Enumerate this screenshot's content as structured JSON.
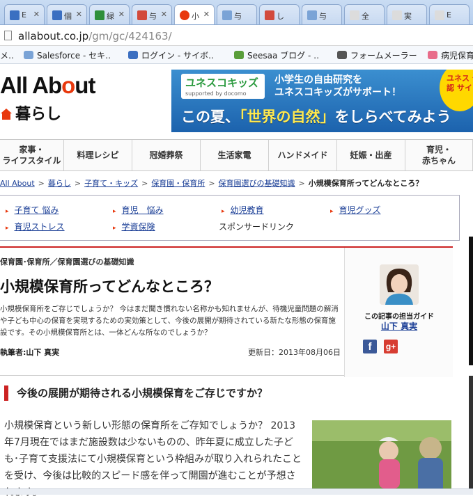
{
  "browser": {
    "tabs": [
      {
        "label": "E",
        "color": "#3b6fc1",
        "active": false
      },
      {
        "label": "個",
        "color": "#3b6fc1",
        "active": false
      },
      {
        "label": "緑",
        "color": "#2f8f3a",
        "active": false
      },
      {
        "label": "与",
        "color": "#d24a3c",
        "active": false
      },
      {
        "label": "小",
        "color": "#e8380d",
        "active": true
      },
      {
        "label": "与",
        "color": "#7aa3d6",
        "active": false
      },
      {
        "label": "し",
        "color": "#d24a3c",
        "active": false
      },
      {
        "label": "与",
        "color": "#7aa3d6",
        "active": false
      },
      {
        "label": "全",
        "color": "#dcdcdc",
        "active": false
      },
      {
        "label": "実",
        "color": "#dcdcdc",
        "active": false
      },
      {
        "label": "E",
        "color": "#dcdcdc",
        "active": false
      }
    ],
    "url_host": "allabout.co.jp",
    "url_path": "/gm/gc/424163/",
    "bookmarks": [
      {
        "label": "メ‥",
        "color": "#cccccc"
      },
      {
        "label": "Salesforce - セキ‥",
        "color": "#7aa3d6"
      },
      {
        "label": "ログイン - サイボ‥",
        "color": "#3b6fc1"
      },
      {
        "label": "Seesaa ブログ - ‥",
        "color": "#5a9e3a"
      },
      {
        "label": "フォームメーラー",
        "color": "#555555"
      },
      {
        "label": "病児保育",
        "color": "#e86c8a"
      }
    ]
  },
  "site": {
    "logo": "All About",
    "section": "暮らし",
    "banner": {
      "brand": "ユネスコキッズ",
      "brand_sub": "supported by docomo",
      "top_line1": "小学生の自由研究を",
      "top_line2": "ユネスコキッズがサポート！",
      "big_pre": "この夏、",
      "big_em": "「世界の自然」",
      "big_post": "をしらべてみよう",
      "sticker": "ユネス 公認 サイト"
    },
    "nav": [
      "家事・\nライフスタイル",
      "料理レシピ",
      "冠婚葬祭",
      "生活家電",
      "ハンドメイド",
      "妊娠・出産",
      "育児・\n赤ちゃん"
    ],
    "breadcrumb": [
      "All About",
      "暮らし",
      "子育て・キッズ",
      "保育園・保育所",
      "保育園選びの基礎知識"
    ],
    "breadcrumb_current": "小規模保育所ってどんなところ？"
  },
  "sponsor": {
    "links": [
      "子育て 悩み",
      "育児　悩み",
      "幼児教育",
      "育児グッズ",
      "育児ストレス",
      "学資保険"
    ],
    "label": "スポンサードリンク"
  },
  "article": {
    "category": "保育園･保育所／保育園選びの基礎知識",
    "title": "小規模保育所ってどんなところ？",
    "lead": "小規模保育所をご存じでしょうか？ 今はまだ聞き慣れない名称かも知れませんが、待機児童問題の解消や子ども中心の保育を実現するための実効策として、今後の展開が期待されている新たな形態の保育施設です。その小規模保育所とは、一体どんな所なのでしょうか？",
    "author": "執筆者:山下 真実",
    "updated": "更新日：2013年08月06日",
    "guide_label": "この記事の担当ガイド",
    "guide_name": "山下 真実"
  },
  "body": {
    "heading": "今後の展開が期待される小規模保育をご存じですか？",
    "text": "小規模保育という新しい形態の保育所をご存知でしょうか？ 2013年7月現在ではまだ施設数は少ないものの、昨年夏に成立した子ども･子育て支援法にて小規模保育という枠組みが取り入れられたことを受け、今後は比較的スピード感を伴って開園が進むことが予想されます。"
  }
}
